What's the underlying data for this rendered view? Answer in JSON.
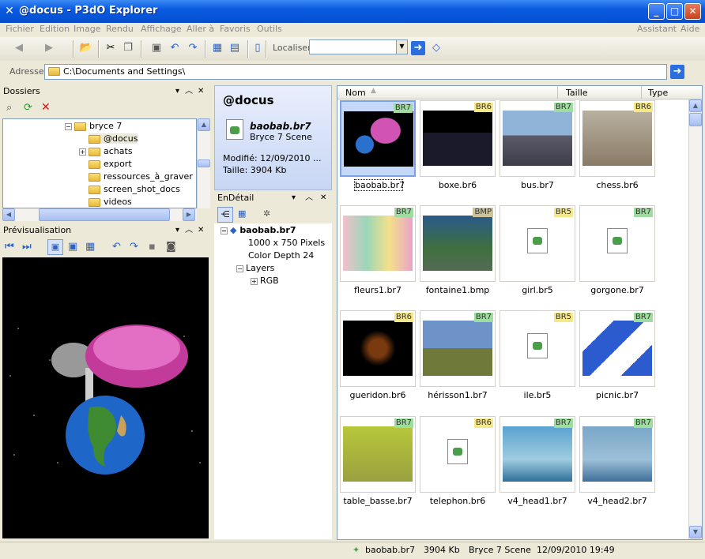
{
  "window": {
    "title": "@docus - P3dO Explorer"
  },
  "menu": {
    "items": [
      "Fichier",
      "Edition",
      "Image",
      "Rendu",
      "Affichage",
      "Aller à",
      "Favoris",
      "Outils"
    ],
    "right": [
      "Assistant",
      "Aide"
    ]
  },
  "toolbar": {
    "locate_label": "Localiser",
    "locate_value": ""
  },
  "address": {
    "label": "Adresse",
    "value": "C:\\Documents and Settings\\"
  },
  "folders": {
    "title": "Dossiers",
    "items": [
      {
        "label": "bryce 7",
        "expanded": true
      },
      {
        "label": "@docus",
        "selected": true
      },
      {
        "label": "achats",
        "expandable": true
      },
      {
        "label": "export"
      },
      {
        "label": "ressources_à_graver"
      },
      {
        "label": "screen_shot_docs"
      },
      {
        "label": "videos"
      }
    ]
  },
  "preview": {
    "title": "Prévisualisation"
  },
  "info": {
    "folder": "@docus",
    "filename": "baobab.br7",
    "filetype": "Bryce 7 Scene",
    "modified": "Modifié: 12/09/2010 ...",
    "size": "Taille: 3904 Kb"
  },
  "detail": {
    "title": "EnDétail",
    "root": "baobab.br7",
    "items": [
      "1000 x 750 Pixels",
      "Color Depth 24",
      "Layers",
      "RGB"
    ]
  },
  "columns": {
    "name": "Nom",
    "size": "Taille",
    "type": "Type"
  },
  "files": [
    {
      "name": "baobab.br7",
      "tag": "BR7",
      "tagc": "g",
      "selected": true
    },
    {
      "name": "boxe.br6",
      "tag": "BR6",
      "tagc": "y"
    },
    {
      "name": "bus.br7",
      "tag": "BR7",
      "tagc": "g"
    },
    {
      "name": "chess.br6",
      "tag": "BR6",
      "tagc": "y"
    },
    {
      "name": "fleurs1.br7",
      "tag": "BR7",
      "tagc": "g"
    },
    {
      "name": "fontaine1.bmp",
      "tag": "BMP",
      "tagc": "b"
    },
    {
      "name": "girl.br5",
      "tag": "BR5",
      "tagc": "y"
    },
    {
      "name": "gorgone.br7",
      "tag": "BR7",
      "tagc": "g"
    },
    {
      "name": "gueridon.br6",
      "tag": "BR6",
      "tagc": "y"
    },
    {
      "name": "hérisson1.br7",
      "tag": "BR7",
      "tagc": "g"
    },
    {
      "name": "ile.br5",
      "tag": "BR5",
      "tagc": "y"
    },
    {
      "name": "picnic.br7",
      "tag": "BR7",
      "tagc": "g"
    },
    {
      "name": "table_basse.br7",
      "tag": "BR7",
      "tagc": "g"
    },
    {
      "name": "telephon.br6",
      "tag": "BR6",
      "tagc": "y"
    },
    {
      "name": "v4_head1.br7",
      "tag": "BR7",
      "tagc": "g"
    },
    {
      "name": "v4_head2.br7",
      "tag": "BR7",
      "tagc": "g"
    }
  ],
  "status": {
    "file": "baobab.br7",
    "size": "3904 Kb",
    "type": "Bryce 7 Scene",
    "date": "12/09/2010 19:49"
  }
}
